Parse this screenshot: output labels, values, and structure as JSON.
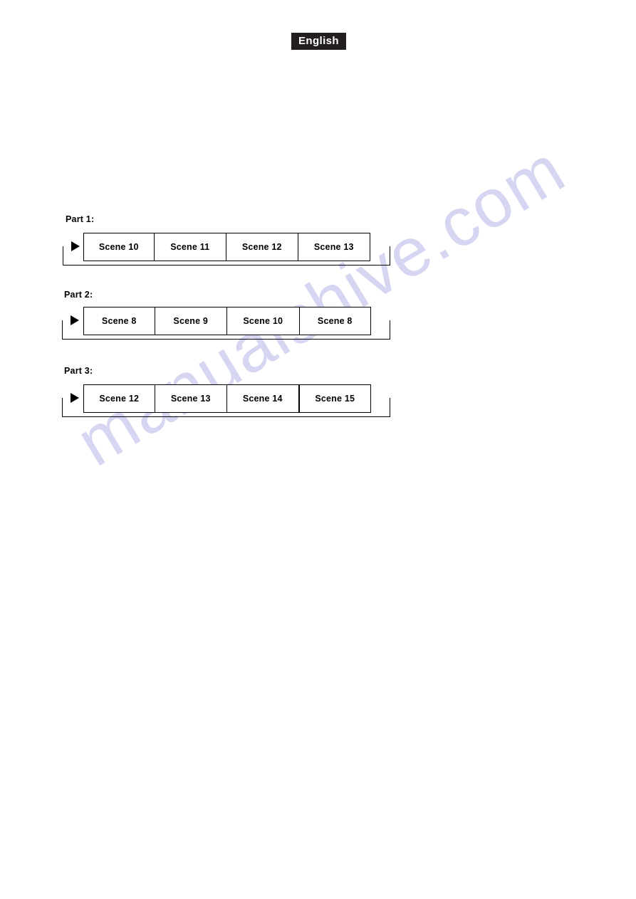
{
  "page": {
    "language_badge": "English",
    "watermark": "manualshive.com",
    "watermark_color": "#d6d6f2",
    "badge_bg": "#231f20",
    "badge_fg": "#ffffff",
    "line_color": "#000000",
    "background": "#ffffff"
  },
  "diagram": {
    "type": "loop-sequence",
    "parts": [
      {
        "label": "Part 1:",
        "scenes": [
          "Scene 10",
          "Scene 11",
          "Scene 12",
          "Scene 13"
        ],
        "loop": "feedback-to-start"
      },
      {
        "label": "Part 2:",
        "scenes": [
          "Scene 8",
          "Scene 9",
          "Scene 10",
          "Scene 8"
        ],
        "loop": "feedback-to-start"
      },
      {
        "label": "Part 3:",
        "scenes": [
          "Scene 12",
          "Scene 13",
          "Scene 14",
          "Scene 15"
        ],
        "loop": "feedback-to-start"
      }
    ]
  }
}
